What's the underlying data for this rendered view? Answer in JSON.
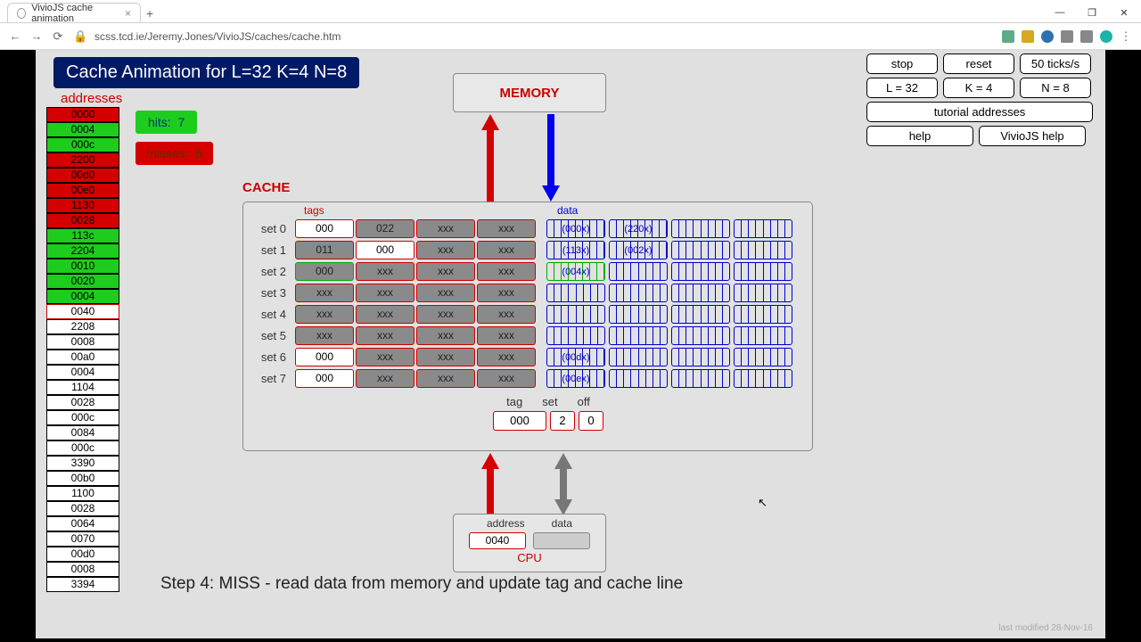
{
  "browser": {
    "tab_title": "VivioJS cache animation",
    "url": "scss.tcd.ie/Jeremy.Jones/VivioJS/caches/cache.htm",
    "winbtns": {
      "min": "—",
      "max": "❐",
      "close": "✕"
    }
  },
  "title": "Cache Animation for L=32 K=4 N=8",
  "addresses_label": "addresses",
  "hits": {
    "label": "hits:",
    "value": "7"
  },
  "misses": {
    "label": "misses:",
    "value": "6"
  },
  "controls": {
    "row1": [
      "stop",
      "reset",
      "50 ticks/s"
    ],
    "row2": [
      "L = 32",
      "K = 4",
      "N = 8"
    ],
    "row3": "tutorial addresses",
    "row4": [
      "help",
      "VivioJS help"
    ]
  },
  "memory_label": "MEMORY",
  "cache_label": "CACHE",
  "tags_label": "tags",
  "data_label": "data",
  "tag_set_off": {
    "labels": [
      "tag",
      "set",
      "off"
    ],
    "tag": "000",
    "set": "2",
    "off": "0"
  },
  "cpu": {
    "hdr": [
      "address",
      "data"
    ],
    "addr": "0040",
    "label": "CPU"
  },
  "step_text": "Step 4: MISS - read data from memory and update tag and cache line",
  "modified": "last modified 28-Nov-16",
  "addresses": [
    {
      "v": "0000",
      "c": "red"
    },
    {
      "v": "0004",
      "c": "green"
    },
    {
      "v": "000c",
      "c": "green"
    },
    {
      "v": "2200",
      "c": "red"
    },
    {
      "v": "00d0",
      "c": "red"
    },
    {
      "v": "00e0",
      "c": "red"
    },
    {
      "v": "1130",
      "c": "red"
    },
    {
      "v": "0028",
      "c": "red"
    },
    {
      "v": "113c",
      "c": "green"
    },
    {
      "v": "2204",
      "c": "green"
    },
    {
      "v": "0010",
      "c": "green"
    },
    {
      "v": "0020",
      "c": "green"
    },
    {
      "v": "0004",
      "c": "green"
    },
    {
      "v": "0040",
      "c": "active"
    },
    {
      "v": "2208",
      "c": ""
    },
    {
      "v": "0008",
      "c": ""
    },
    {
      "v": "00a0",
      "c": ""
    },
    {
      "v": "0004",
      "c": ""
    },
    {
      "v": "1104",
      "c": ""
    },
    {
      "v": "0028",
      "c": ""
    },
    {
      "v": "000c",
      "c": ""
    },
    {
      "v": "0084",
      "c": ""
    },
    {
      "v": "000c",
      "c": ""
    },
    {
      "v": "3390",
      "c": ""
    },
    {
      "v": "00b0",
      "c": ""
    },
    {
      "v": "1100",
      "c": ""
    },
    {
      "v": "0028",
      "c": ""
    },
    {
      "v": "0064",
      "c": ""
    },
    {
      "v": "0070",
      "c": ""
    },
    {
      "v": "00d0",
      "c": ""
    },
    {
      "v": "0008",
      "c": ""
    },
    {
      "v": "3394",
      "c": ""
    }
  ],
  "cache_rows": [
    {
      "set": "set 0",
      "tags": [
        {
          "t": "000",
          "g": 0
        },
        {
          "t": "022",
          "g": 1
        },
        {
          "t": "xxx",
          "g": 1
        },
        {
          "t": "xxx",
          "g": 1
        }
      ],
      "data": [
        "(000x)",
        "(220x)",
        "",
        ""
      ]
    },
    {
      "set": "set 1",
      "tags": [
        {
          "t": "011",
          "g": 1
        },
        {
          "t": "000",
          "g": 0
        },
        {
          "t": "xxx",
          "g": 1
        },
        {
          "t": "xxx",
          "g": 1
        }
      ],
      "data": [
        "(113x)",
        "(002x)",
        "",
        ""
      ]
    },
    {
      "set": "set 2",
      "tags": [
        {
          "t": "000",
          "g": 1,
          "gb": 1
        },
        {
          "t": "xxx",
          "g": 1
        },
        {
          "t": "xxx",
          "g": 1
        },
        {
          "t": "xxx",
          "g": 1
        }
      ],
      "data": [
        "(004x)",
        "",
        "",
        ""
      ],
      "green": 1
    },
    {
      "set": "set 3",
      "tags": [
        {
          "t": "xxx",
          "g": 1
        },
        {
          "t": "xxx",
          "g": 1
        },
        {
          "t": "xxx",
          "g": 1
        },
        {
          "t": "xxx",
          "g": 1
        }
      ],
      "data": [
        "",
        "",
        "",
        ""
      ]
    },
    {
      "set": "set 4",
      "tags": [
        {
          "t": "xxx",
          "g": 1
        },
        {
          "t": "xxx",
          "g": 1
        },
        {
          "t": "xxx",
          "g": 1
        },
        {
          "t": "xxx",
          "g": 1
        }
      ],
      "data": [
        "",
        "",
        "",
        ""
      ]
    },
    {
      "set": "set 5",
      "tags": [
        {
          "t": "xxx",
          "g": 1
        },
        {
          "t": "xxx",
          "g": 1
        },
        {
          "t": "xxx",
          "g": 1
        },
        {
          "t": "xxx",
          "g": 1
        }
      ],
      "data": [
        "",
        "",
        "",
        ""
      ]
    },
    {
      "set": "set 6",
      "tags": [
        {
          "t": "000",
          "g": 0
        },
        {
          "t": "xxx",
          "g": 1
        },
        {
          "t": "xxx",
          "g": 1
        },
        {
          "t": "xxx",
          "g": 1
        }
      ],
      "data": [
        "(00dx)",
        "",
        "",
        ""
      ]
    },
    {
      "set": "set 7",
      "tags": [
        {
          "t": "000",
          "g": 0
        },
        {
          "t": "xxx",
          "g": 1
        },
        {
          "t": "xxx",
          "g": 1
        },
        {
          "t": "xxx",
          "g": 1
        }
      ],
      "data": [
        "(00ex)",
        "",
        "",
        ""
      ]
    }
  ]
}
